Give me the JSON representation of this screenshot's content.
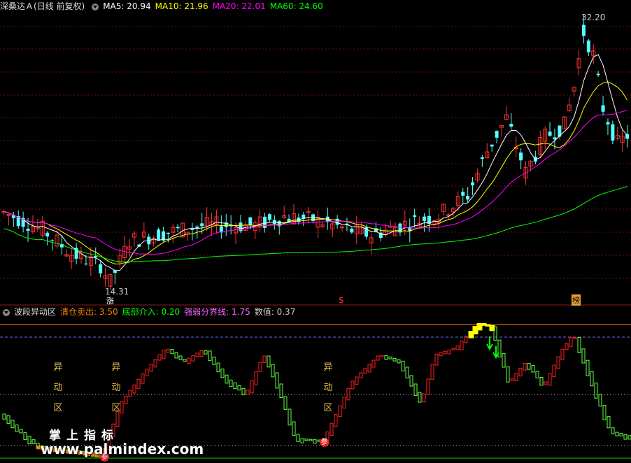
{
  "top_header": {
    "title": "深桑达Ａ",
    "mode": "(日线 前复权)",
    "ma5": "MA5: 20.94",
    "ma10": "MA10: 21.96",
    "ma20": "MA20: 22.01",
    "ma60": "MA60: 24.60"
  },
  "bottom_header": {
    "title": "波段异动区",
    "sell": "清仓卖出: 3.50",
    "buy": "底部介入: 0.20",
    "divider": "强弱分界线: 1.75",
    "value": "数值: 0.37"
  },
  "price_annotations": {
    "high": "32.20",
    "low": "14.31"
  },
  "markers": {
    "zhang": "涨",
    "dollar": "$",
    "bang": "榜",
    "can": "参"
  },
  "zone_labels": [
    "异",
    "动",
    "区"
  ],
  "watermark": {
    "line1": "掌上指标",
    "line2": "www.palmindex.com"
  },
  "colors": {
    "up": "#ff3232",
    "down": "#54ffff",
    "ma5": "#ffffff",
    "ma10": "#ffff00",
    "ma20": "#ff00ff",
    "ma60": "#00ff00",
    "sell": "#ff8000",
    "buy": "#00ff00",
    "divider": "#ff66ff"
  },
  "chart_data": [
    {
      "type": "candlestick",
      "title": "深桑达Ａ (日线 前复权)",
      "y_labels": [
        "32.20",
        "14.31"
      ],
      "series": [
        {
          "name": "MA5",
          "last": 20.94
        },
        {
          "name": "MA10",
          "last": 21.96
        },
        {
          "name": "MA20",
          "last": 22.01
        },
        {
          "name": "MA60",
          "last": 24.6
        }
      ],
      "high": 32.2,
      "low": 14.31
    },
    {
      "type": "bar",
      "title": "波段异动区",
      "series": [
        {
          "name": "清仓卖出",
          "value": 3.5
        },
        {
          "name": "底部介入",
          "value": 0.2
        },
        {
          "name": "强弱分界线",
          "value": 1.75
        },
        {
          "name": "数值",
          "value": 0.37
        }
      ]
    }
  ]
}
